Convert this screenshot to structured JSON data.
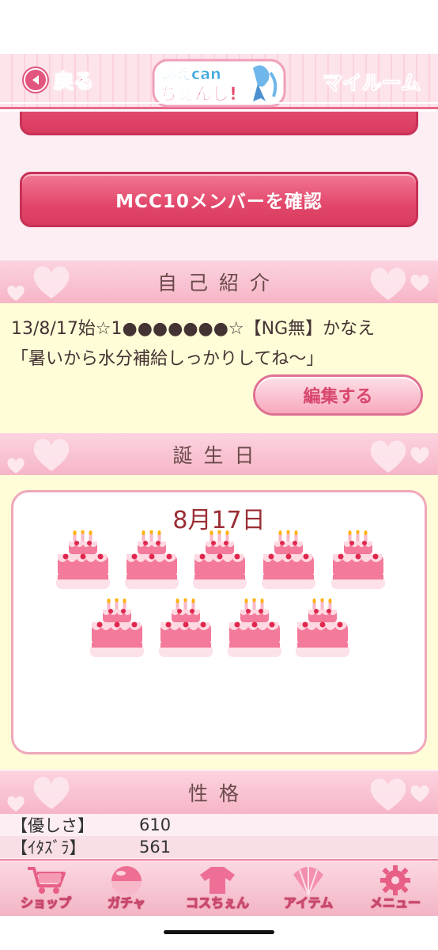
{
  "header": {
    "back_label": "戻る",
    "myroom_label": "マイルーム",
    "logo_text_top": "あえcan",
    "logo_text_bottom": "ちぇんじ!"
  },
  "buttons": {
    "confirm_members": "MCC10メンバーを確認",
    "edit": "編集する"
  },
  "sections": {
    "intro_title": "自己紹介",
    "birthday_title": "誕生日",
    "personality_title": "性格"
  },
  "intro": {
    "line1": "13/8/17始☆1●●●●●●●☆【NG無】かなえ",
    "line2": "「暑いから水分補給しっかりしてね～」"
  },
  "birthday": {
    "date": "8月17日",
    "cake_count": 9
  },
  "stats": [
    {
      "label": "【優しさ】",
      "value": "610"
    },
    {
      "label": "【ｲﾀｽﾞﾗ】",
      "value": "561"
    }
  ],
  "nav": [
    {
      "label": "ショップ",
      "icon": "cart-icon"
    },
    {
      "label": "ガチャ",
      "icon": "gacha-capsule-icon"
    },
    {
      "label": "コスちぇん",
      "icon": "costume-icon"
    },
    {
      "label": "アイテム",
      "icon": "item-shell-icon"
    },
    {
      "label": "メニュー",
      "icon": "gear-icon"
    }
  ],
  "colors": {
    "accent_pink": "#e2486b",
    "section_pink": "#f6b5c7",
    "cream": "#fffdd7",
    "date_text": "#9b2d34"
  }
}
